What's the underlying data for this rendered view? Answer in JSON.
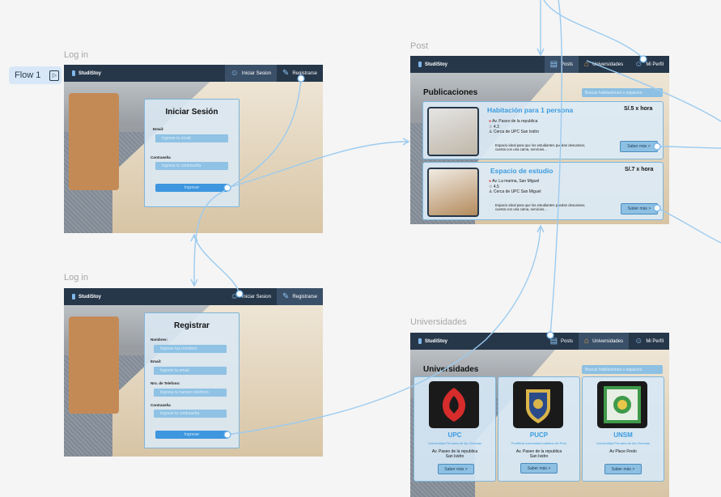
{
  "flow": {
    "label": "Flow 1",
    "icon": "play-frame-icon"
  },
  "brand": "StudiStoy",
  "frames": {
    "login": {
      "label": "Log in"
    },
    "register": {
      "label": "Log in"
    },
    "post": {
      "label": "Post"
    },
    "universities": {
      "label": "Universidades"
    }
  },
  "auth_nav": {
    "login": "Iniciar Sesion",
    "register": "Registrarse"
  },
  "main_nav": {
    "posts": "Posts",
    "universities": "Universidades",
    "profile": "Mi Perfil"
  },
  "login_form": {
    "title": "Iniciar Sesión",
    "email_label": "Email:",
    "email_placeholder": "Ingrese tu email",
    "password_label": "Contraseña",
    "password_placeholder": "Ingrese tu contraseña",
    "submit": "Ingresar"
  },
  "register_form": {
    "title": "Registrar",
    "name_label": "Nombres:",
    "name_placeholder": "Ingrese tus nombres",
    "email_label": "Email:",
    "email_placeholder": "Ingrese tu email",
    "phone_label": "Nro. de Telefono:",
    "phone_placeholder": "Ingresa tu numero telefono",
    "password_label": "Contraseña",
    "password_placeholder": "Ingrese tu contraseña",
    "submit": "Ingresar"
  },
  "posts_page": {
    "title": "Publicaciones",
    "search_placeholder": "Buscar habitaciones o espacios",
    "items": [
      {
        "title": "Habitación para 1 persona",
        "price": "S/.5 x hora",
        "address": "Av. Paseo de la republica",
        "rating": "4.3",
        "near": "Cerca de UPC San Isidro",
        "desc": "Espacio ideal para que los estudiantes puedan descansar, cuenta con una cama, servicios...",
        "more": "Saber más >"
      },
      {
        "title": "Espacio de estudio",
        "price": "S/.7 x hora",
        "address": "Av. La marina, San Miguel",
        "rating": "4.5",
        "near": "Cerca de UPC San Miguel",
        "desc": "Espacio ideal para que los estudiantes puedan descansar, cuenta con una cama, servicios...",
        "more": "Saber más >"
      }
    ]
  },
  "universities_page": {
    "title": "Universidades",
    "search_placeholder": "Buscar habitaciones o espacios",
    "items": [
      {
        "short": "UPC",
        "full": "Universidad Peruana de las Ciencias",
        "address1": "Av. Paseo de la republica",
        "address2": "San Isidro",
        "more": "Saber más >",
        "logo_bg": "#1a1a1a",
        "logo_fg": "#d62c2c"
      },
      {
        "short": "PUCP",
        "full": "Pontificia universidad católica del Perú",
        "address1": "Av. Paseo de la republica",
        "address2": "San Isidro",
        "more": "Saber más >",
        "logo_bg": "#1a1a1a",
        "logo_fg": "#d8b44a"
      },
      {
        "short": "UNSM",
        "full": "Universidad Peruana de las Ciencias",
        "address1": "Av Place Findo",
        "address2": "",
        "more": "Saber más >",
        "logo_bg": "#1a1a1a",
        "logo_fg": "#3f9a4a"
      }
    ]
  },
  "colors": {
    "nav": "#26374a",
    "accent": "#3b9be0",
    "connector": "#9ccbef"
  }
}
